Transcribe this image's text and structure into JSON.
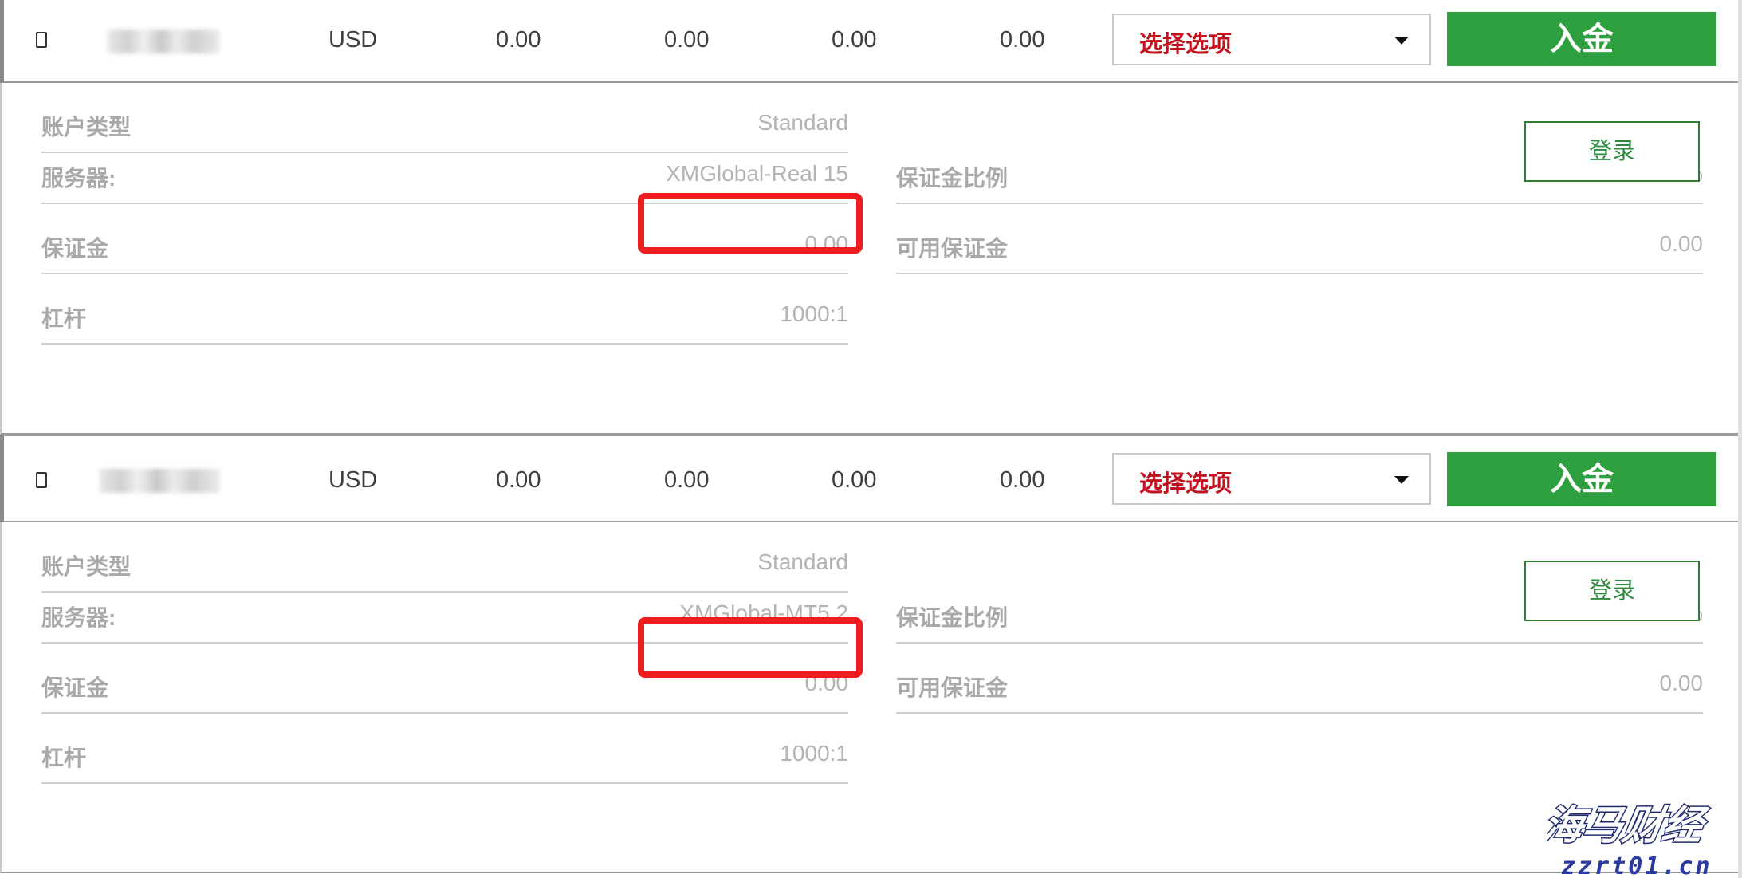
{
  "accounts": [
    {
      "currency": "USD",
      "values": [
        "0.00",
        "0.00",
        "0.00",
        "0.00"
      ],
      "select_label": "选择选项",
      "deposit_label": "入金",
      "login_label": "登录",
      "details": {
        "account_type_label": "账户类型",
        "account_type_value": "Standard",
        "server_label": "服务器:",
        "server_value": "XMGlobal-Real 15",
        "margin_label": "保证金",
        "margin_value": "0.00",
        "leverage_label": "杠杆",
        "leverage_value": "1000:1",
        "margin_ratio_label": "保证金比例",
        "margin_ratio_value": "0.00%",
        "free_margin_label": "可用保证金",
        "free_margin_value": "0.00"
      }
    },
    {
      "currency": "USD",
      "values": [
        "0.00",
        "0.00",
        "0.00",
        "0.00"
      ],
      "select_label": "选择选项",
      "deposit_label": "入金",
      "login_label": "登录",
      "details": {
        "account_type_label": "账户类型",
        "account_type_value": "Standard",
        "server_label": "服务器:",
        "server_value": "XMGlobal-MT5 2",
        "margin_label": "保证金",
        "margin_value": "0.00",
        "leverage_label": "杠杆",
        "leverage_value": "1000:1",
        "margin_ratio_label": "保证金比例",
        "margin_ratio_value": "0.00%",
        "free_margin_label": "可用保证金",
        "free_margin_value": "0.00"
      }
    }
  ],
  "watermark": {
    "brand": "海马财经",
    "site": "zzrt01.cn"
  },
  "colors": {
    "deposit_green": "#2e9f3e",
    "select_red": "#c1121f",
    "highlight_red": "#ee1d1d"
  }
}
